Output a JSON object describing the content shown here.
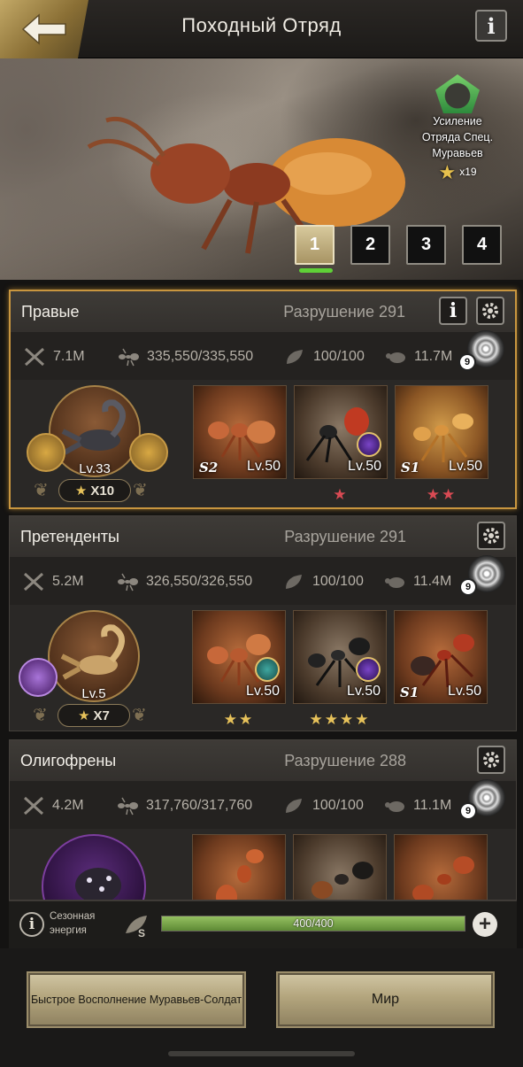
{
  "header": {
    "title": "Походный Отряд",
    "back_icon": "arrow-left-icon",
    "info_label": "i"
  },
  "banner": {
    "boost_line1": "Усиление",
    "boost_line2": "Отряда Спец.",
    "boost_line3": "Муравьев",
    "boost_count": "x19",
    "tabs": [
      "1",
      "2",
      "3",
      "4"
    ],
    "active_tab": "1"
  },
  "squads": [
    {
      "name": "Правые",
      "destruction_label": "Разрушение",
      "destruction": "291",
      "attack": "7.1M",
      "ants": "335,550/335,550",
      "food": "100/100",
      "power": "11.7M",
      "swirl_badge": "9",
      "commander": {
        "level": "Lv.33",
        "stars": "X10"
      },
      "units": [
        {
          "rank": "S2",
          "level": "Lv.50",
          "stars": ""
        },
        {
          "rank": "",
          "level": "Lv.50",
          "stars": "★"
        },
        {
          "rank": "S1",
          "level": "Lv.50",
          "stars": "★★"
        }
      ]
    },
    {
      "name": "Претенденты",
      "destruction_label": "Разрушение",
      "destruction": "291",
      "attack": "5.2M",
      "ants": "326,550/326,550",
      "food": "100/100",
      "power": "11.4M",
      "swirl_badge": "9",
      "commander": {
        "level": "Lv.5",
        "stars": "X7"
      },
      "units": [
        {
          "rank": "",
          "level": "Lv.50",
          "stars": "★★"
        },
        {
          "rank": "",
          "level": "Lv.50",
          "stars": "★★★★"
        },
        {
          "rank": "S1",
          "level": "Lv.50",
          "stars": ""
        }
      ]
    },
    {
      "name": "Олигофрены",
      "destruction_label": "Разрушение",
      "destruction": "288",
      "attack": "4.2M",
      "ants": "317,760/317,760",
      "food": "100/100",
      "power": "11.1M",
      "swirl_badge": "9"
    }
  ],
  "energy": {
    "label_line1": "Сезонная",
    "label_line2": "энергия",
    "value": "400/400",
    "fill_fraction": 1.0
  },
  "buttons": {
    "refill": "Быстрое Восполнение Муравьев-Солдат",
    "world": "Мир"
  },
  "colors": {
    "accent_gold": "#c9963f",
    "energy_green": "#7fae4a",
    "star_red": "#d94a53",
    "star_gold": "#e7c25a"
  }
}
